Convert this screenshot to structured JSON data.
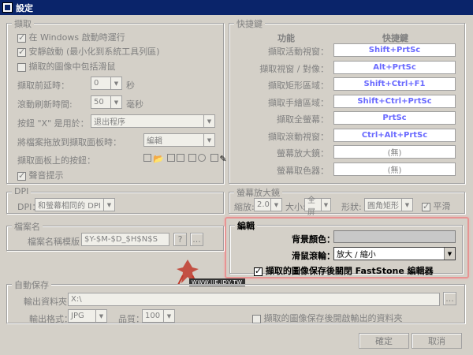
{
  "window": {
    "title": "設定"
  },
  "capture": {
    "legend": "擷取",
    "run_at_startup": "在 Windows 啟動時運行",
    "silent_start": "安靜啟動 (最小化到系統工具列區)",
    "include_cursor": "擷取的圖像中包括滑鼠",
    "delay_label": "擷取前延時：",
    "delay_value": "0",
    "delay_unit": "秒",
    "scroll_label": "滾動刷新時間:",
    "scroll_value": "50",
    "scroll_unit": "毫秒",
    "x_button_label": "按鈕 \"X\" 是用於：",
    "x_button_value": "退出程序",
    "drag_label": "將檔案拖放到擷取面板時：",
    "drag_value": "編輯",
    "panel_buttons_label": "擷取面板上的按鈕：",
    "sound_label": "聲音提示"
  },
  "hotkeys": {
    "legend": "快捷鍵",
    "col_function": "功能",
    "col_hotkey": "快捷鍵",
    "rows": [
      {
        "name": "擷取活動視窗：",
        "key": "Shift+PrtSc"
      },
      {
        "name": "擷取視窗 / 對像：",
        "key": "Alt+PrtSc"
      },
      {
        "name": "擷取矩形區域：",
        "key": "Shift+Ctrl+F1"
      },
      {
        "name": "擷取手繪區域：",
        "key": "Shift+Ctrl+PrtSc"
      },
      {
        "name": "擷取全螢幕：",
        "key": "PrtSc"
      },
      {
        "name": "擷取滾動視窗：",
        "key": "Ctrl+Alt+PrtSc"
      },
      {
        "name": "螢幕放大鏡：",
        "key": "(無)"
      },
      {
        "name": "螢幕取色器：",
        "key": "(無)"
      }
    ]
  },
  "dpi": {
    "legend": "DPI",
    "label": "DPI：",
    "value": "和螢幕相同的 DPI"
  },
  "magnifier": {
    "legend": "螢幕放大鏡",
    "zoom_label": "縮放:",
    "zoom_value": "2.0",
    "size_label": "大小:",
    "size_value": "全屏",
    "shape_label": "形狀:",
    "shape_value": "圓角矩形",
    "smooth_label": "平滑"
  },
  "editor": {
    "legend": "編輯",
    "bg_label": "背景顏色：",
    "wheel_label": "滑鼠滾輪：",
    "wheel_value": "放大 / 縮小",
    "close_after_save": "擷取的圖像保存後關閉 FastStone 編輯器"
  },
  "filename": {
    "legend": "檔案名",
    "template_label": "檔案名稱模版：",
    "template_value": "$Y-$M-$D_$H$N$S",
    "help_btn": "?",
    "more_btn": "..."
  },
  "watermark": {
    "text": "WWW.JIE.IDV.TW"
  },
  "autosave": {
    "legend": "自動保存",
    "output_folder_label": "輸出資料夾：",
    "output_folder_value": "X:\\",
    "browse_btn": "...",
    "format_label": "輸出格式：",
    "format_value": "JPG",
    "quality_label": "品質：",
    "quality_value": "100",
    "open_folder_label": "擷取的圖像保存後開啟輸出的資料夾"
  },
  "buttons": {
    "ok": "確定",
    "cancel": "取消"
  }
}
